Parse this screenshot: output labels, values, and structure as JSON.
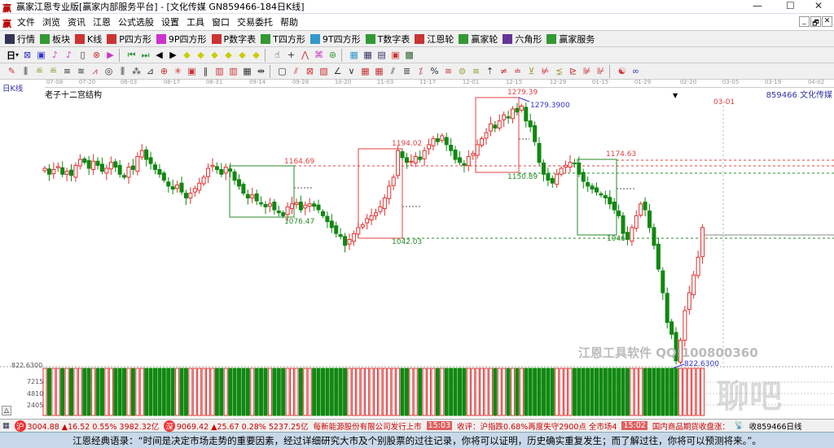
{
  "window": {
    "title": "赢家江恩专业版[赢家内部服务平台] - [文化传媒  GN859466-184日K线]",
    "minimize": "—",
    "maximize": "☐",
    "close": "✕",
    "mdi": [
      "_",
      "🗗",
      "✕"
    ]
  },
  "menu": [
    "文件",
    "浏览",
    "资讯",
    "江恩",
    "公式选股",
    "设置",
    "工具",
    "窗口",
    "交易委托",
    "帮助"
  ],
  "toolbar1": [
    {
      "icon": "grid-icon",
      "label": "行情",
      "color": "#335"
    },
    {
      "icon": "blocks-icon",
      "label": "板块",
      "color": "#393"
    },
    {
      "icon": "kline-icon",
      "label": "K线",
      "color": "#c33"
    },
    {
      "icon": "p-square-icon",
      "label": "P四方形",
      "color": "#c33"
    },
    {
      "icon": "p9-square-icon",
      "label": "9P四方形",
      "color": "#c3c"
    },
    {
      "icon": "pn-table-icon",
      "label": "P数字表",
      "color": "#c33"
    },
    {
      "icon": "t-square-icon",
      "label": "T四方形",
      "color": "#393"
    },
    {
      "icon": "t9-square-icon",
      "label": "9T四方形",
      "color": "#39c"
    },
    {
      "icon": "tn-table-icon",
      "label": "T数字表",
      "color": "#393"
    },
    {
      "icon": "gann-wheel-icon",
      "label": "江恩轮",
      "color": "#c33"
    },
    {
      "icon": "winner-wheel-icon",
      "label": "赢家轮",
      "color": "#393"
    },
    {
      "icon": "hexagon-icon",
      "label": "六角形",
      "color": "#639"
    },
    {
      "icon": "dollar-icon",
      "label": "赢家服务",
      "color": "#393"
    }
  ],
  "period_label": "日",
  "chart": {
    "period": "日K线",
    "indicator": "老子十二宫结构",
    "stock": "859466  文化传媒",
    "marker_date": "03-01",
    "dates": [
      "07-08",
      "07-20",
      "08-03",
      "08-17",
      "08-31",
      "09-14",
      "09-28",
      "10-20",
      "11-03",
      "11-17",
      "12-01",
      "12-15",
      "12-29",
      "01-15",
      "01-29",
      "02-20",
      "03-05",
      "03-19",
      "04-02"
    ],
    "price_labels": {
      "p1164": "1164.69",
      "p1076": "1076.47",
      "p1194": "1194.02",
      "p1042": "1042.03",
      "p1279": "1279.39",
      "p1279b": "1279.3900",
      "p1150": "1150.89",
      "p1174": "1174.63",
      "p1046": "1046",
      "low": "822.6300"
    },
    "volume_axis": [
      "822.6300",
      "7215",
      "4810",
      "2405"
    ],
    "watermark": "江恩工具软件 QQ:100800360",
    "watermark2": "聊吧",
    "colors": {
      "up": "#e03030",
      "down": "#118811",
      "box_green": "#2a8a2a",
      "box_red": "#e04040"
    }
  },
  "chart_data": {
    "type": "candlestick",
    "ylim": [
      822.63,
      1279.39
    ],
    "closes": [
      1160,
      1150,
      1158,
      1163,
      1150,
      1155,
      1148,
      1165,
      1175,
      1170,
      1160,
      1172,
      1165,
      1155,
      1160,
      1170,
      1162,
      1150,
      1145,
      1162,
      1158,
      1180,
      1190,
      1175,
      1168,
      1158,
      1150,
      1140,
      1130,
      1125,
      1132,
      1120,
      1110,
      1118,
      1126,
      1135,
      1145,
      1160,
      1165,
      1158,
      1150,
      1162,
      1155,
      1140,
      1130,
      1118,
      1110,
      1115,
      1105,
      1100,
      1095,
      1100,
      1090,
      1085,
      1080,
      1095,
      1100,
      1102,
      1090,
      1098,
      1100,
      1096,
      1090,
      1080,
      1070,
      1060,
      1050,
      1045,
      1030,
      1040,
      1050,
      1060,
      1065,
      1075,
      1080,
      1085,
      1095,
      1110,
      1130,
      1145,
      1190,
      1178,
      1170,
      1172,
      1180,
      1175,
      1190,
      1200,
      1210,
      1205,
      1215,
      1200,
      1190,
      1175,
      1170,
      1165,
      1180,
      1185,
      1200,
      1210,
      1220,
      1235,
      1228,
      1240,
      1250,
      1245,
      1260,
      1255,
      1265,
      1240,
      1230,
      1205,
      1170,
      1150,
      1140,
      1135,
      1150,
      1160,
      1165,
      1170,
      1168,
      1150,
      1138,
      1130,
      1125,
      1120,
      1115,
      1110,
      1100,
      1090,
      1080,
      1050,
      1040,
      1060,
      1080,
      1100,
      1090,
      1060,
      1030,
      990,
      950,
      900,
      880,
      835,
      870,
      920,
      950,
      980,
      1010,
      1060
    ]
  },
  "status": {
    "sh_index": "3004.88 ▲16.52 0.55% 3982.32亿",
    "sz_index": "9069.42 ▲25.67 0.28% 5237.25亿",
    "news1": "每新能源股份有限公司发行上市",
    "time1": "15:03",
    "news2": "收评：沪指跌0.68%再度失守2900点 全市场4",
    "time2": "15:02",
    "news3": "国内商品期货收盘涨：",
    "right": "收859466日线"
  },
  "quote": "江恩经典语录：“时间是决定市场走势的重要因素，经过详细研究大市及个别股票的过往记录，你将可以证明，历史确实重复发生；而了解过往，你将可以预测将来。”。"
}
